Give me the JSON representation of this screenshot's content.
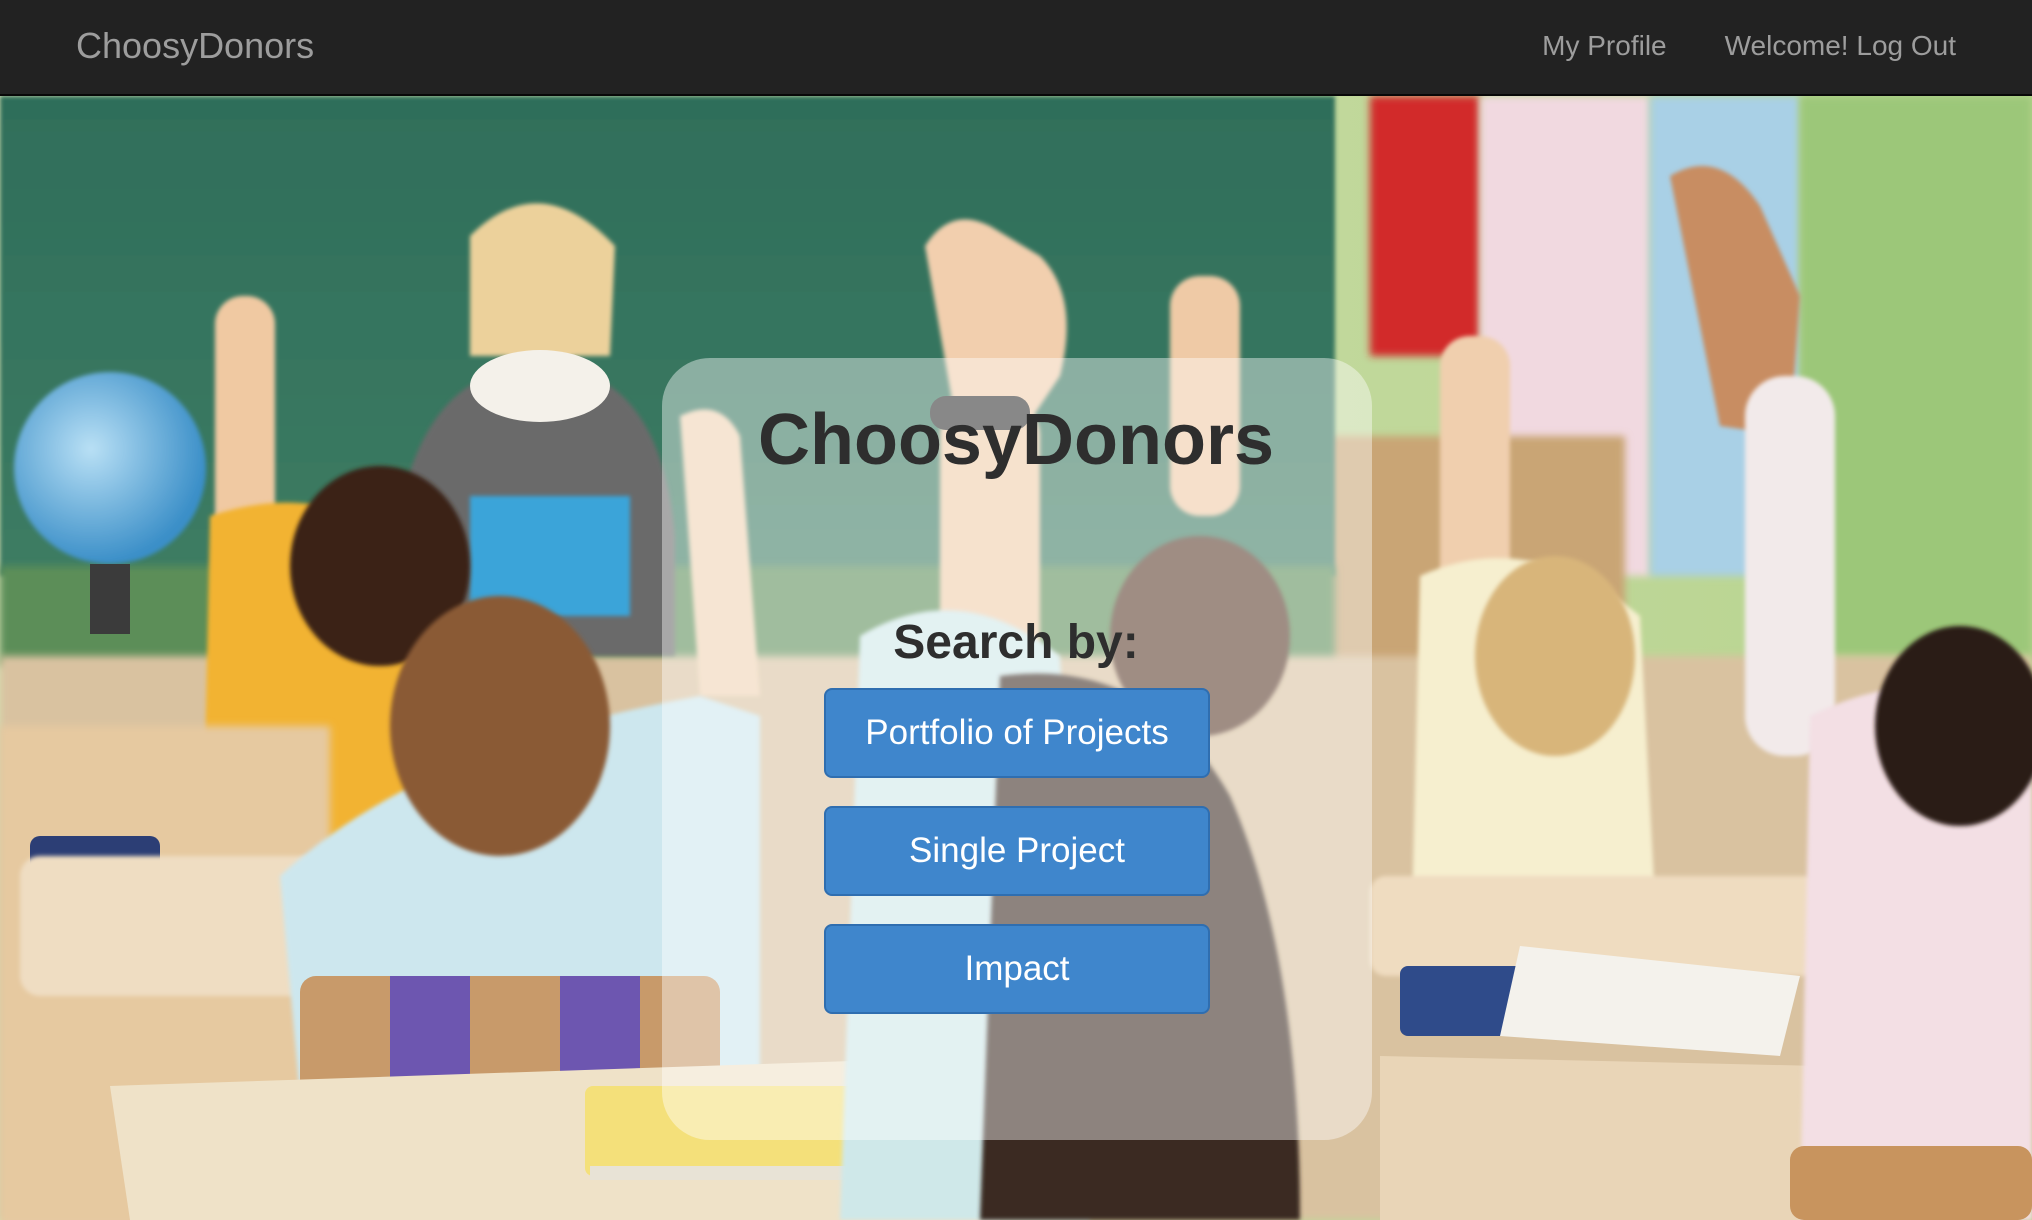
{
  "navbar": {
    "brand": "ChoosyDonors",
    "links": [
      "My Profile",
      "Welcome! Log Out"
    ]
  },
  "hero": {
    "title": "ChoosyDonors",
    "subtitle": "Search by:",
    "buttons": [
      "Portfolio of Projects",
      "Single Project",
      "Impact"
    ]
  },
  "colors": {
    "navbar_bg": "#222222",
    "nav_text": "#9d9d9d",
    "button_bg": "#3f86cc",
    "title_text": "#2e2e2e"
  }
}
